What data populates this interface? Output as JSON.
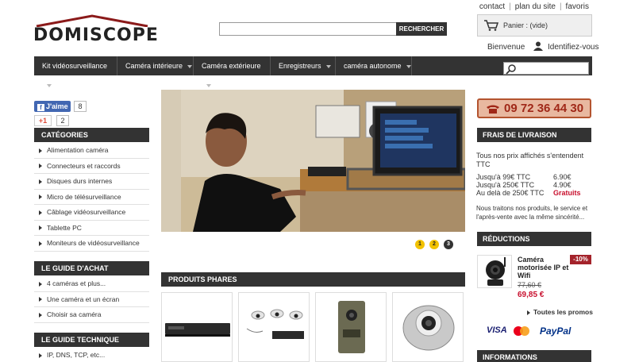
{
  "header": {
    "logo": "DOMISCOPE",
    "toplinks": [
      "contact",
      "plan du site",
      "favoris"
    ],
    "search_button": "RECHERCHER",
    "cart_label": "Panier : (vide)",
    "welcome": "Bienvenue",
    "login": "Identifiez-vous"
  },
  "nav": {
    "items": [
      {
        "label": "Kit vidéosurveillance"
      },
      {
        "label": "Caméra intérieure"
      },
      {
        "label": "Caméra extérieure"
      },
      {
        "label": "Enregistreurs"
      },
      {
        "label": "caméra autonome"
      }
    ]
  },
  "social": {
    "fb_label": "J'aime",
    "fb_count": "8",
    "gp_label": "+1",
    "gp_count": "2"
  },
  "left": {
    "categories_title": "CATÉGORIES",
    "categories": [
      "Alimentation caméra",
      "Connecteurs et raccords",
      "Disques durs internes",
      "Micro de télésurveillance",
      "Câblage vidéosurveillance",
      "Tablette PC",
      "Moniteurs de vidéosurveillance"
    ],
    "guide_achat_title": "LE GUIDE D'ACHAT",
    "guide_achat": [
      "4 caméras et plus...",
      "Une caméra et un écran",
      "Choisir sa caméra"
    ],
    "guide_tech_title": "LE GUIDE TECHNIQUE",
    "guide_tech": [
      "IP, DNS, TCP, etc..."
    ]
  },
  "center": {
    "slider_dots": [
      "1",
      "2",
      "3"
    ],
    "produits_title": "PRODUITS PHARES"
  },
  "right": {
    "phone": "09 72 36 44 30",
    "frais_title": "FRAIS DE LIVRAISON",
    "frais_intro": "Tous nos prix affichés s'entendent TTC",
    "frais_rows": [
      {
        "label": "Jusqu'à 99€ TTC",
        "price": "6.90€"
      },
      {
        "label": "Jusqu'à 250€ TTC",
        "price": "4.90€"
      },
      {
        "label": "Au delà de 250€ TTC",
        "price": "Gratuits"
      }
    ],
    "frais_note": "Nous traitons nos produits, le service et l'après-vente avec la même sincérité...",
    "reductions_title": "RÉDUCTIONS",
    "promo": {
      "name": "Caméra motorisée IP et Wifi",
      "badge": "-10%",
      "old_price": "77,60 €",
      "new_price": "69,85 €"
    },
    "promo_link": "Toutes les promos",
    "payments": [
      "VISA",
      "PayPal"
    ],
    "informations_title": "INFORMATIONS"
  },
  "colors": {
    "dark_bar": "#333333",
    "accent_red": "#c8102e",
    "phone_bg": "#e8b8a0",
    "slider_active": "#f2c200"
  }
}
